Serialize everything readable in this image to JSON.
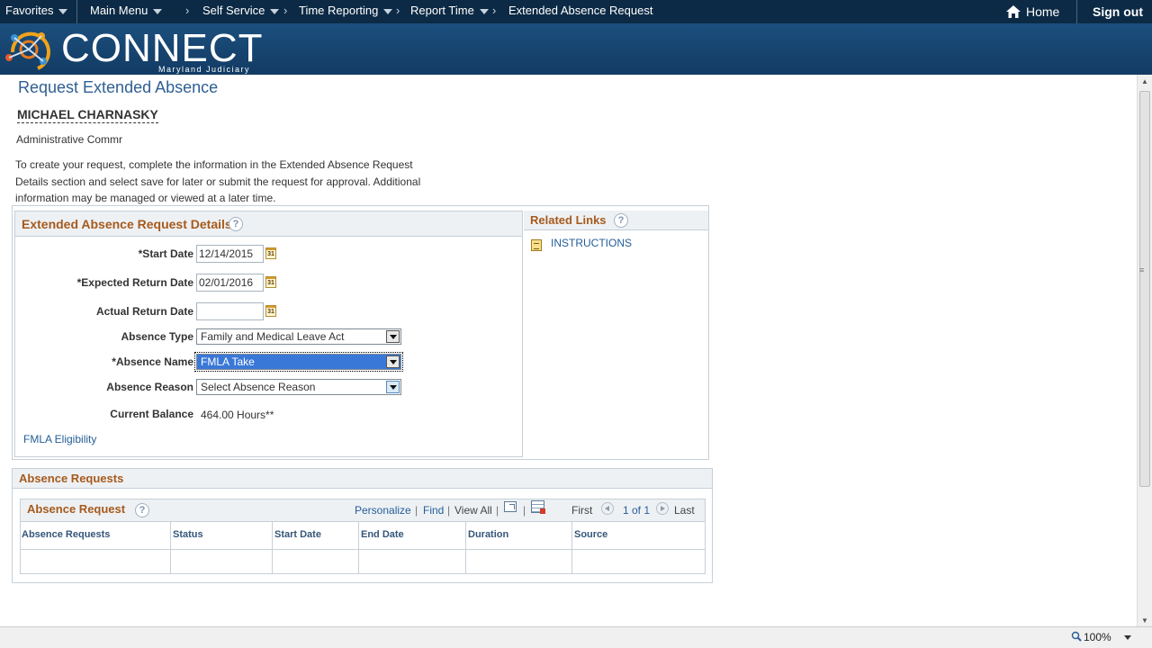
{
  "nav": {
    "favorites": "Favorites",
    "main_menu": "Main Menu",
    "breadcrumbs": [
      "Self Service",
      "Time Reporting",
      "Report Time",
      "Extended Absence Request"
    ],
    "home": "Home",
    "sign_out": "Sign out"
  },
  "banner": {
    "logo_text": "CONNECT",
    "logo_sub": "Maryland Judiciary"
  },
  "page": {
    "title": "Request Extended Absence",
    "employee_name": "MICHAEL CHARNASKY",
    "employee_title": "Administrative Commr",
    "intro": "To create your request, complete the information in the Extended Absence Request Details section and select save for later or submit the request for approval. Additional information may be managed or viewed at a later time."
  },
  "details": {
    "title": "Extended Absence Request Details",
    "help": "?",
    "start_date_label": "*Start Date",
    "start_date_value": "12/14/2015",
    "expected_return_label": "*Expected Return Date",
    "expected_return_value": "02/01/2016",
    "actual_return_label": "Actual Return Date",
    "actual_return_value": "",
    "absence_type_label": "Absence Type",
    "absence_type_value": "Family and Medical Leave Act",
    "absence_name_label": "*Absence Name",
    "absence_name_value": "FMLA Take",
    "absence_reason_label": "Absence Reason",
    "absence_reason_value": "Select Absence Reason",
    "current_balance_label": "Current Balance",
    "current_balance_value": "464.00 Hours**",
    "fmla_link": "FMLA Eligibility",
    "calendar_glyph": "31"
  },
  "related_links": {
    "title": "Related Links",
    "help": "?",
    "instructions": "INSTRUCTIONS"
  },
  "absence_requests": {
    "section_title": "Absence Requests",
    "grid_title": "Absence Request",
    "help": "?",
    "personalize": "Personalize",
    "find": "Find",
    "view_all": "View All",
    "first": "First",
    "page_info": "1 of 1",
    "last": "Last",
    "separator": "|",
    "columns": [
      "Absence Requests",
      "Status",
      "Start Date",
      "End Date",
      "Duration",
      "Source"
    ]
  },
  "statusbar": {
    "zoom": "100%"
  },
  "colors": {
    "topbar": "#0c2a45",
    "banner": "#1c4f7e",
    "section_title": "#a65a1c",
    "link": "#235d98",
    "page_title": "#2f5f93"
  }
}
